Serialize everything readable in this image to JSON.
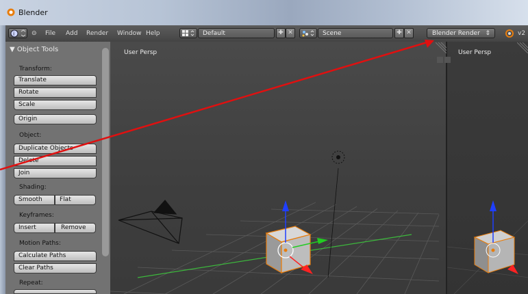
{
  "window": {
    "title": "Blender"
  },
  "topbar": {
    "menus": [
      "File",
      "Add",
      "Render",
      "Window",
      "Help"
    ],
    "layout_value": "Default",
    "scene_value": "Scene",
    "render_engine": "Blender Render",
    "version_partial": "v2"
  },
  "toolpanel": {
    "header": "▼ Object Tools",
    "transform_label": "Transform:",
    "translate": "Translate",
    "rotate": "Rotate",
    "scale": "Scale",
    "origin": "Origin",
    "object_label": "Object:",
    "duplicate": "Duplicate Objects",
    "delete": "Delete",
    "join": "Join",
    "shading_label": "Shading:",
    "smooth": "Smooth",
    "flat": "Flat",
    "keyframes_label": "Keyframes:",
    "insert": "Insert",
    "remove": "Remove",
    "motion_label": "Motion Paths:",
    "calculate": "Calculate Paths",
    "clear": "Clear Paths",
    "repeat_label": "Repeat:"
  },
  "viewport": {
    "label": "User Persp"
  },
  "viewport2": {
    "label": "User Persp"
  },
  "colors": {
    "annotation_arrow": "#e01010",
    "accent_orange": "#e87d0d"
  }
}
